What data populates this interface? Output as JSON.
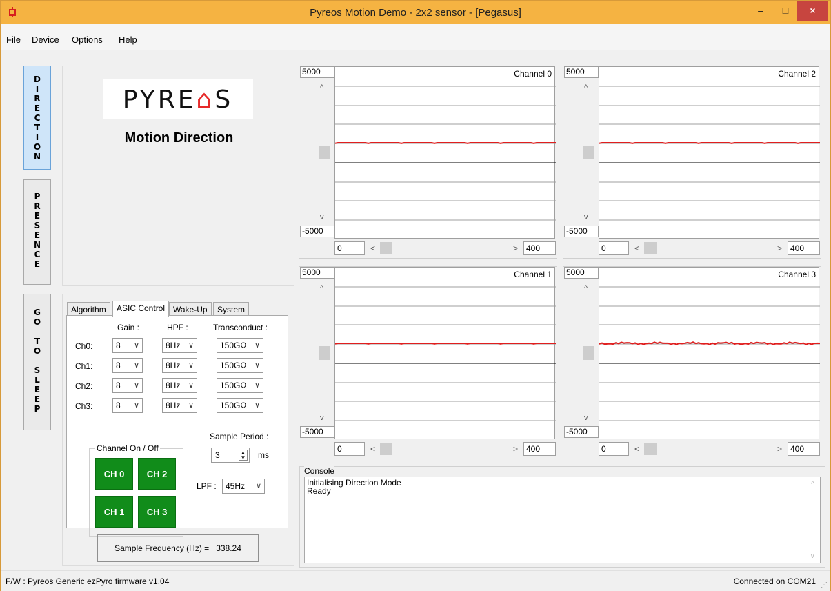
{
  "window": {
    "title": "Pyreos Motion Demo - 2x2 sensor - [Pegasus]",
    "minimize": "–",
    "maximize": "□",
    "close": "×"
  },
  "menu": [
    "File",
    "Device",
    "Options",
    "Help"
  ],
  "side_buttons": {
    "direction": "DIRECTION",
    "presence": "PRESENCE",
    "sleep_line1": "GO",
    "sleep_line2": "TO",
    "sleep_line3": "SLEEP"
  },
  "logo": {
    "text_before": "PYRE",
    "text_mark": "⌂",
    "text_after": "S",
    "subtitle": "Motion Direction"
  },
  "tabs": [
    {
      "label": "Algorithm"
    },
    {
      "label": "ASIC Control",
      "active": true
    },
    {
      "label": "Wake-Up"
    },
    {
      "label": "System"
    }
  ],
  "asic": {
    "headers": {
      "gain": "Gain :",
      "hpf": "HPF :",
      "transconduct": "Transconduct :"
    },
    "rows": [
      {
        "label": "Ch0:",
        "gain": "8",
        "hpf": "8Hz",
        "trans": "150GΩ"
      },
      {
        "label": "Ch1:",
        "gain": "8",
        "hpf": "8Hz",
        "trans": "150GΩ"
      },
      {
        "label": "Ch2:",
        "gain": "8",
        "hpf": "8Hz",
        "trans": "150GΩ"
      },
      {
        "label": "Ch3:",
        "gain": "8",
        "hpf": "8Hz",
        "trans": "150GΩ"
      }
    ],
    "channel_group_title": "Channel On / Off",
    "channel_buttons": [
      "CH 0",
      "CH 2",
      "CH 1",
      "CH 3"
    ],
    "sample_period_label": "Sample Period :",
    "sample_period_value": "3",
    "sample_period_unit": "ms",
    "lpf_label": "LPF :",
    "lpf_value": "45Hz",
    "caret": "∨",
    "spin_up": "▲",
    "spin_down": "▼"
  },
  "sample_frequency": {
    "label": "Sample Frequency (Hz) =",
    "value": "338.24"
  },
  "charts": [
    {
      "title": "Channel 0",
      "ymax": "5000",
      "ymin": "-5000",
      "xmin": "0",
      "xmax": "400"
    },
    {
      "title": "Channel 2",
      "ymax": "5000",
      "ymin": "-5000",
      "xmin": "0",
      "xmax": "400"
    },
    {
      "title": "Channel 1",
      "ymax": "5000",
      "ymin": "-5000",
      "xmin": "0",
      "xmax": "400"
    },
    {
      "title": "Channel 3",
      "ymax": "5000",
      "ymin": "-5000",
      "xmin": "0",
      "xmax": "400"
    }
  ],
  "scroll_glyphs": {
    "up": "^",
    "down": "v",
    "left": "<",
    "right": ">"
  },
  "console": {
    "title": "Console",
    "lines": [
      "Initialising Direction Mode",
      "Ready"
    ]
  },
  "status": {
    "firmware": "F/W : Pyreos Generic ezPyro firmware v1.04",
    "connection": "Connected on COM21"
  },
  "colors": {
    "titlebar": "#f5b342",
    "close": "#c7453f",
    "channel_on": "#118c1a",
    "signal": "#e01e1e",
    "active_side": "#cfe5f9"
  }
}
